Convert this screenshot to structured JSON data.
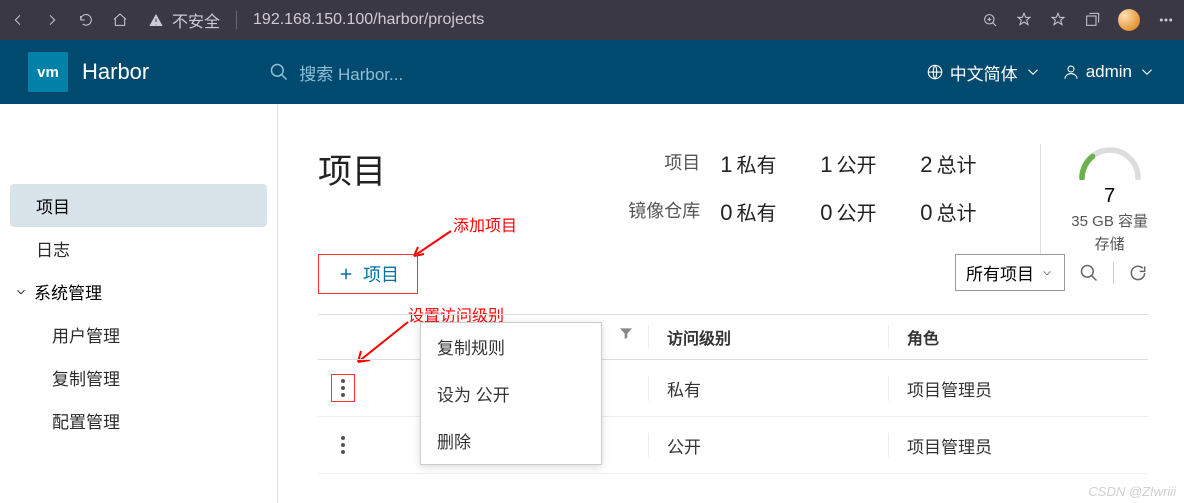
{
  "browser": {
    "insecure_label": "不安全",
    "url": "192.168.150.100/harbor/projects"
  },
  "header": {
    "logo_text": "vm",
    "product": "Harbor",
    "search_placeholder": "搜索 Harbor...",
    "lang": "中文简体",
    "user": "admin"
  },
  "sidebar": {
    "projects": "项目",
    "logs": "日志",
    "sys_admin": "系统管理",
    "users": "用户管理",
    "replication": "复制管理",
    "config": "配置管理"
  },
  "main": {
    "title": "项目",
    "labels": {
      "project": "项目",
      "repositories": "镜像仓库"
    },
    "stats": {
      "private": "私有",
      "public": "公开",
      "total": "总计",
      "proj_private": "1",
      "proj_public": "1",
      "proj_total": "2",
      "repo_private": "0",
      "repo_public": "0",
      "repo_total": "0"
    },
    "gauge": {
      "value": "7",
      "cap1": "35 GB 容量",
      "cap2": "存储"
    },
    "anno_add": "添加项目",
    "new_project": "项目",
    "filter_dropdown": "所有项目",
    "anno_access": "设置访问级别",
    "table": {
      "col_access": "访问级别",
      "col_role": "角色"
    },
    "ctx": {
      "copy": "复制规则",
      "set_public": "设为 公开",
      "delete": "删除"
    },
    "rows": [
      {
        "access": "私有",
        "role": "项目管理员"
      },
      {
        "access": "公开",
        "role": "项目管理员"
      }
    ]
  },
  "watermark": "CSDN @ZIwriii"
}
